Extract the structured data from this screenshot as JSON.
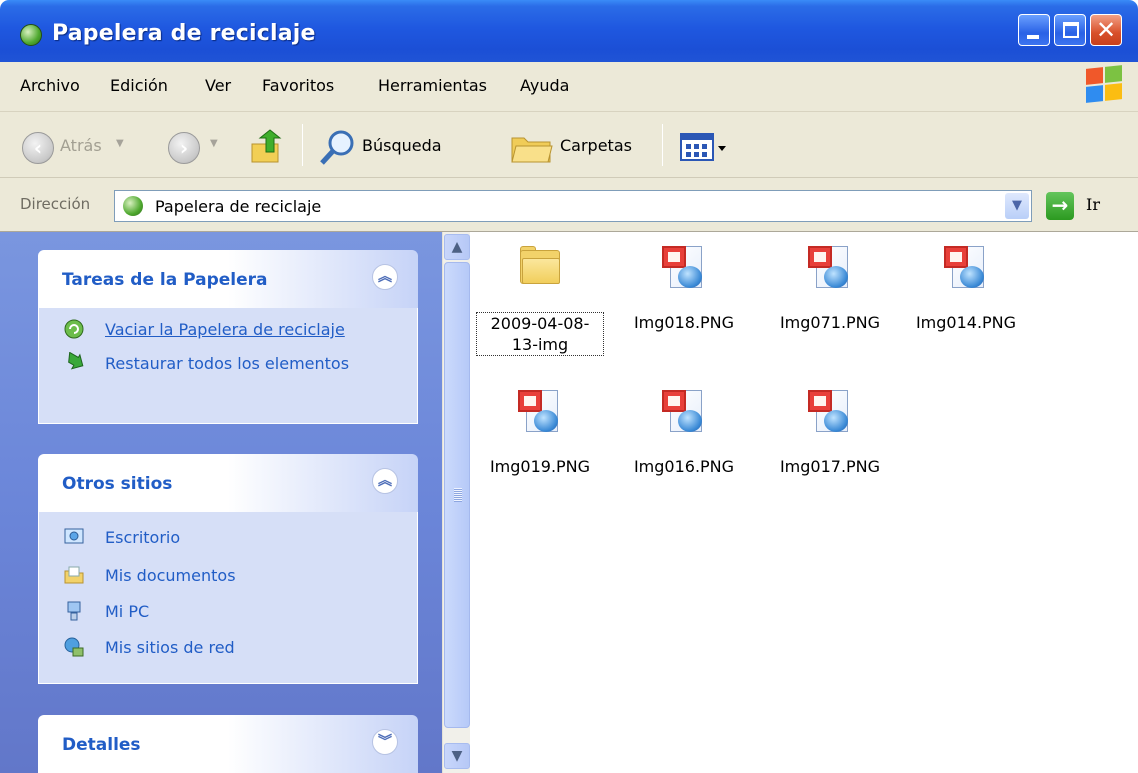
{
  "window": {
    "title": "Papelera de reciclaje"
  },
  "menu": [
    "Archivo",
    "Edición",
    "Ver",
    "Favoritos",
    "Herramientas",
    "Ayuda"
  ],
  "toolbar": {
    "back_label": "Atrás",
    "search_label": "Búsqueda",
    "folders_label": "Carpetas"
  },
  "address": {
    "label": "Dirección",
    "value": "Papelera de reciclaje",
    "go_label": "Ir"
  },
  "panels": {
    "recycle_tasks": {
      "title": "Tareas de la Papelera",
      "items": [
        {
          "label": "Vaciar la Papelera de reciclaje",
          "icon": "empty-recycle-bin-icon"
        },
        {
          "label": "Restaurar todos los elementos",
          "icon": "restore-icon"
        }
      ]
    },
    "other_places": {
      "title": "Otros sitios",
      "items": [
        {
          "label": "Escritorio",
          "icon": "desktop-icon"
        },
        {
          "label": "Mis documentos",
          "icon": "my-documents-icon"
        },
        {
          "label": "Mi PC",
          "icon": "my-computer-icon"
        },
        {
          "label": "Mis sitios de red",
          "icon": "network-places-icon"
        }
      ]
    },
    "details": {
      "title": "Detalles"
    }
  },
  "files": [
    {
      "name": "2009-04-08-13-img",
      "type": "folder",
      "selected": true
    },
    {
      "name": "Img018.PNG",
      "type": "png"
    },
    {
      "name": "Img071.PNG",
      "type": "png"
    },
    {
      "name": "Img014.PNG",
      "type": "png"
    },
    {
      "name": "Img019.PNG",
      "type": "png"
    },
    {
      "name": "Img016.PNG",
      "type": "png"
    },
    {
      "name": "Img017.PNG",
      "type": "png"
    }
  ],
  "colors": {
    "titlebar": "#1f58e0",
    "task_link": "#215dc6",
    "pane_bg": "#6b86d9"
  }
}
